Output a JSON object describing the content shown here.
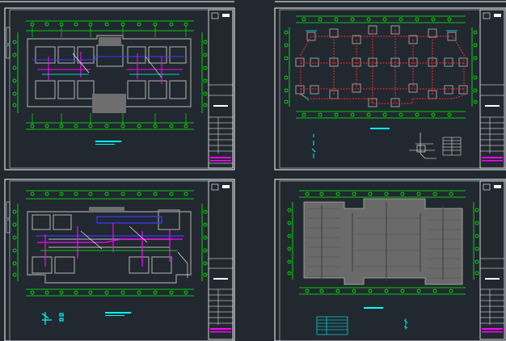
{
  "colors": {
    "background": "#212830",
    "frame": "#ffffff",
    "grid_line": "#00ff00",
    "wall": "#8c8c8c",
    "pipe_magenta": "#ff00ff",
    "pipe_blue": "#3a3aff",
    "pipe_cyan": "#00ffff",
    "pipe_red": "#ff2a2a",
    "title_accent": "#ff00ff"
  },
  "sheets": [
    {
      "id": "sheet-1",
      "kind": "floor-plan-piping",
      "position": "top-left"
    },
    {
      "id": "sheet-2",
      "kind": "column-layout-red-pipe",
      "position": "top-right"
    },
    {
      "id": "sheet-3",
      "kind": "floor-plan-piping-2",
      "position": "bottom-left"
    },
    {
      "id": "sheet-4",
      "kind": "roof-plan",
      "position": "bottom-right"
    }
  ]
}
